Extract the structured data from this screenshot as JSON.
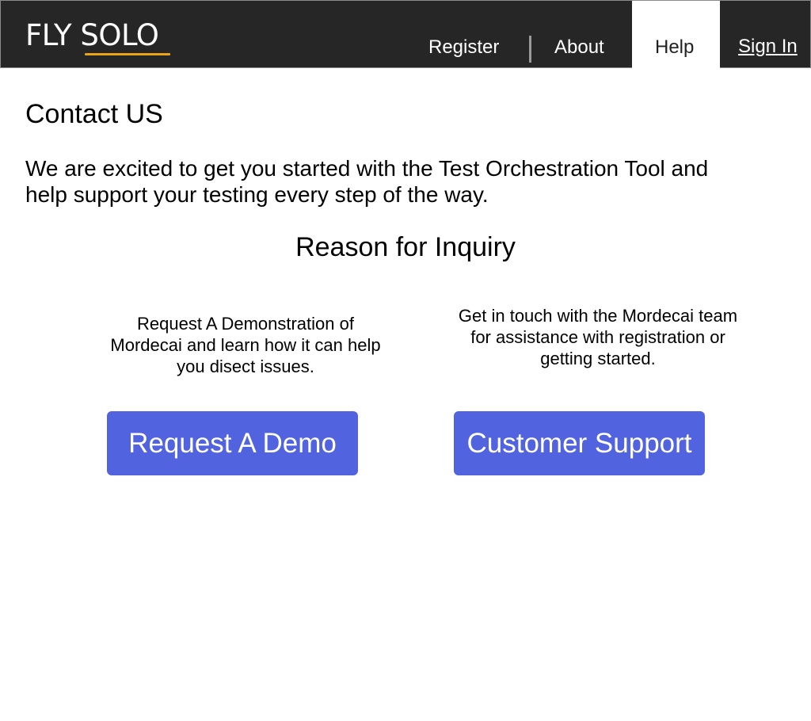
{
  "header": {
    "logo": {
      "text_part1": "FLY ",
      "text_part2": "SOLO",
      "underline_color": "#e8a317"
    },
    "nav": {
      "register": "Register",
      "about": "About",
      "help": "Help",
      "sign_in": "Sign In"
    },
    "active_tab": "Help",
    "colors": {
      "bar": "#262626",
      "text": "#ffffff"
    }
  },
  "main": {
    "title": "Contact US",
    "intro": "We are excited to get you started with the Test Orchestration Tool and help support your testing every step of the way.",
    "reason_title": "Reason for Inquiry",
    "options": [
      {
        "description": "Request A Demonstration of Mordecai and learn how it can help you disect issues.",
        "button_label": "Request A Demo"
      },
      {
        "description": "Get in touch with the Mordecai team for assistance with registration or getting started.",
        "button_label": "Customer Support"
      }
    ],
    "button_color": "#5263e0"
  }
}
